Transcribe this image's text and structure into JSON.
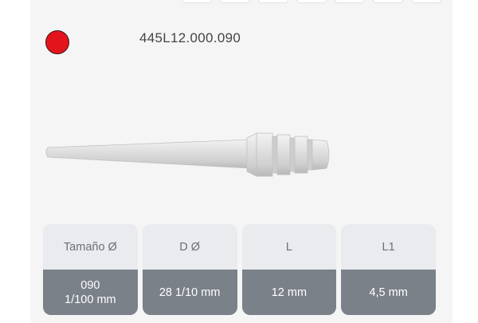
{
  "product": {
    "color_hex": "#e3141b",
    "code": "445L12.000.090"
  },
  "table": {
    "columns": [
      {
        "header": "Tamaño Ø",
        "value": "090\n1/100 mm"
      },
      {
        "header": "D Ø",
        "value": "28 1/10 mm"
      },
      {
        "header": "L",
        "value": "12 mm"
      },
      {
        "header": "L1",
        "value": "4,5 mm"
      }
    ]
  }
}
